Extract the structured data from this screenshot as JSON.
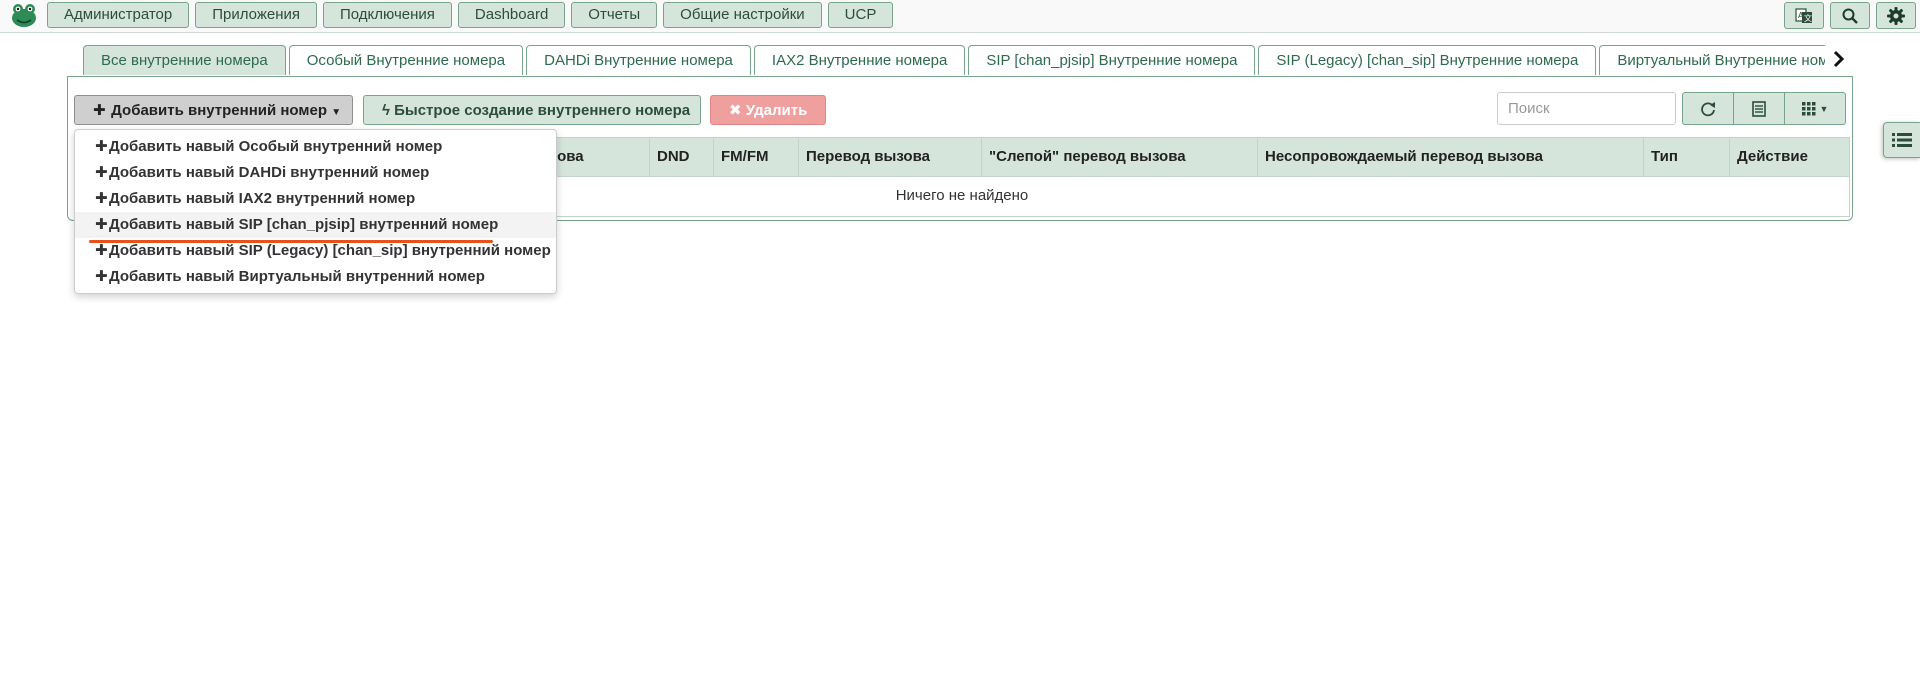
{
  "topbar": {
    "logo_icon": "frog-logo-icon",
    "nav": [
      {
        "label": "Администратор"
      },
      {
        "label": "Приложения"
      },
      {
        "label": "Подключения"
      },
      {
        "label": "Dashboard"
      },
      {
        "label": "Отчеты"
      },
      {
        "label": "Общие настройки"
      },
      {
        "label": "UCP"
      }
    ],
    "tools": [
      "translate-icon",
      "search-icon",
      "gear-icon"
    ]
  },
  "tabs": [
    {
      "label": "Все внутренние номера",
      "active": true
    },
    {
      "label": "Особый Внутренние номера"
    },
    {
      "label": "DAHDi Внутренние номера"
    },
    {
      "label": "IAX2 Внутренние номера"
    },
    {
      "label": "SIP [chan_pjsip] Внутренние номера"
    },
    {
      "label": "SIP (Legacy) [chan_sip] Внутренние номера"
    },
    {
      "label": "Виртуальный Внутренние номера"
    }
  ],
  "toolbar": {
    "add_label": "Добавить внутренний номер",
    "quick_label": "Быстрое создание внутреннего номера",
    "delete_label": "Удалить",
    "search_placeholder": "Поиск",
    "icons": [
      "refresh-icon",
      "columns-toggle-icon",
      "grid-icon"
    ]
  },
  "table": {
    "columns": [
      {
        "label": "зова"
      },
      {
        "label": "DND"
      },
      {
        "label": "FM/FM"
      },
      {
        "label": "Перевод вызова"
      },
      {
        "label": "\"Слепой\" перевод вызова"
      },
      {
        "label": "Несопровождаемый перевод вызова"
      },
      {
        "label": "Тип"
      },
      {
        "label": "Действие"
      }
    ],
    "empty_text": "Ничего не найдено"
  },
  "dropdown": {
    "items": [
      {
        "label": "Добавить навый Особый внутренний номер"
      },
      {
        "label": "Добавить навый DAHDi внутренний номер"
      },
      {
        "label": "Добавить навый IAX2 внутренний номер"
      },
      {
        "label": "Добавить навый SIP [chan_pjsip] внутренний номер",
        "highlighted": true
      },
      {
        "label": "Добавить навый SIP (Legacy) [chan_sip] внутренний номер"
      },
      {
        "label": "Добавить навый Виртуальный внутренний номер"
      }
    ]
  },
  "colors": {
    "accent_green": "#d5e5db",
    "border_green": "#79a48c",
    "delete_red": "#f09f9f",
    "annotation_orange": "#e8501c"
  }
}
